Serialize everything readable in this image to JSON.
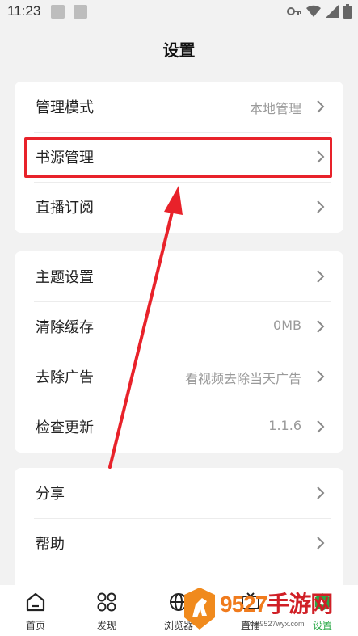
{
  "status_bar": {
    "time": "11:23"
  },
  "header": {
    "title": "设置"
  },
  "groups": [
    {
      "items": [
        {
          "label": "管理模式",
          "value": "本地管理"
        },
        {
          "label": "书源管理",
          "value": ""
        },
        {
          "label": "直播订阅",
          "value": ""
        }
      ]
    },
    {
      "items": [
        {
          "label": "主题设置",
          "value": ""
        },
        {
          "label": "清除缓存",
          "value": "0MB"
        },
        {
          "label": "去除广告",
          "value": "看视频去除当天广告"
        },
        {
          "label": "检查更新",
          "value": "1.1.6"
        }
      ]
    },
    {
      "items": [
        {
          "label": "分享",
          "value": ""
        },
        {
          "label": "帮助",
          "value": ""
        }
      ]
    }
  ],
  "bottom_nav": {
    "items": [
      {
        "label": "首页",
        "icon": "home-icon"
      },
      {
        "label": "发现",
        "icon": "discover-icon"
      },
      {
        "label": "浏览器",
        "icon": "browser-icon"
      },
      {
        "label": "直播",
        "icon": "live-icon"
      },
      {
        "label": "设置",
        "icon": "settings-icon"
      }
    ],
    "active": "设置"
  },
  "watermark": {
    "brand": "9527",
    "brand_cn": "手游网",
    "url": "www.9527wyx.com"
  },
  "colors": {
    "accent": "#27a845",
    "highlight": "#e8222a",
    "background": "#f2f2f2"
  }
}
